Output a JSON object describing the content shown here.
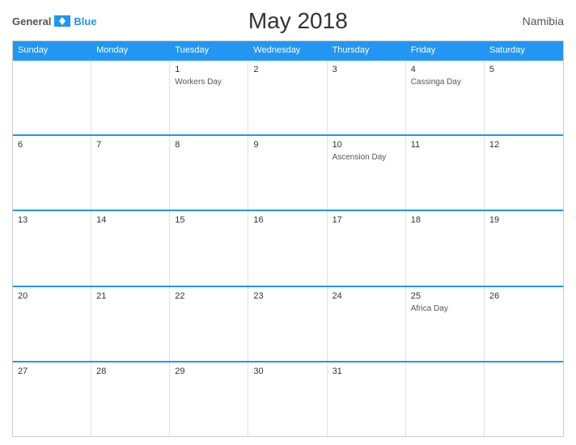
{
  "logo": {
    "general": "General",
    "blue": "Blue"
  },
  "title": "May 2018",
  "country": "Namibia",
  "dayHeaders": [
    "Sunday",
    "Monday",
    "Tuesday",
    "Wednesday",
    "Thursday",
    "Friday",
    "Saturday"
  ],
  "weeks": [
    [
      {
        "num": "",
        "event": ""
      },
      {
        "num": "",
        "event": ""
      },
      {
        "num": "1",
        "event": "Workers Day"
      },
      {
        "num": "2",
        "event": ""
      },
      {
        "num": "3",
        "event": ""
      },
      {
        "num": "4",
        "event": "Cassinga Day"
      },
      {
        "num": "5",
        "event": ""
      }
    ],
    [
      {
        "num": "6",
        "event": ""
      },
      {
        "num": "7",
        "event": ""
      },
      {
        "num": "8",
        "event": ""
      },
      {
        "num": "9",
        "event": ""
      },
      {
        "num": "10",
        "event": "Ascension Day"
      },
      {
        "num": "11",
        "event": ""
      },
      {
        "num": "12",
        "event": ""
      }
    ],
    [
      {
        "num": "13",
        "event": ""
      },
      {
        "num": "14",
        "event": ""
      },
      {
        "num": "15",
        "event": ""
      },
      {
        "num": "16",
        "event": ""
      },
      {
        "num": "17",
        "event": ""
      },
      {
        "num": "18",
        "event": ""
      },
      {
        "num": "19",
        "event": ""
      }
    ],
    [
      {
        "num": "20",
        "event": ""
      },
      {
        "num": "21",
        "event": ""
      },
      {
        "num": "22",
        "event": ""
      },
      {
        "num": "23",
        "event": ""
      },
      {
        "num": "24",
        "event": ""
      },
      {
        "num": "25",
        "event": "Africa Day"
      },
      {
        "num": "26",
        "event": ""
      }
    ],
    [
      {
        "num": "27",
        "event": ""
      },
      {
        "num": "28",
        "event": ""
      },
      {
        "num": "29",
        "event": ""
      },
      {
        "num": "30",
        "event": ""
      },
      {
        "num": "31",
        "event": ""
      },
      {
        "num": "",
        "event": ""
      },
      {
        "num": "",
        "event": ""
      }
    ]
  ]
}
